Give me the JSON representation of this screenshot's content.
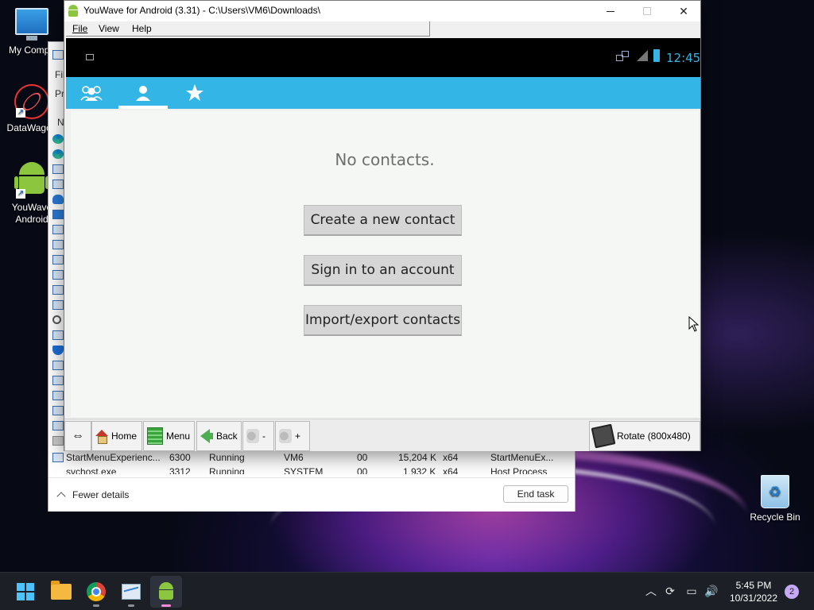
{
  "desktop": {
    "icons": [
      {
        "label": "My Compu",
        "icon": "computer-icon"
      },
      {
        "label": "DataWagon",
        "icon": "datawagon-icon"
      },
      {
        "label": "YouWave Android",
        "line1": "YouWave",
        "line2": "Android",
        "icon": "android-icon"
      },
      {
        "label": "Recycle Bin",
        "icon": "recycle-bin-icon"
      }
    ]
  },
  "taskmgr": {
    "left_labels": [
      "Fil",
      "Pr",
      "N"
    ],
    "rows": [
      {
        "name": "StartMenuExperienc...",
        "pid": "6300",
        "status": "Running",
        "user": "VM6",
        "cpu": "00",
        "memory": "15,204 K",
        "arch": "x64",
        "desc": "StartMenuEx..."
      },
      {
        "name": "svchost.exe",
        "pid": "3312",
        "status": "Running",
        "user": "SYSTEM",
        "cpu": "00",
        "memory": "1,932 K",
        "arch": "x64",
        "desc": "Host Process"
      }
    ],
    "fewer_details": "Fewer details",
    "end_task": "End task"
  },
  "youwave": {
    "title": "YouWave for Android (3.31) - C:\\Users\\VM6\\Downloads\\",
    "menu": {
      "file": "File",
      "view": "View",
      "help": "Help"
    },
    "status_bar": {
      "clock": "12:45",
      "battery_color": "#33b5e5"
    },
    "tabs": [
      {
        "name": "groups",
        "icon": "groups-icon"
      },
      {
        "name": "contacts",
        "icon": "person-icon",
        "selected": true
      },
      {
        "name": "favorites",
        "icon": "star-icon"
      }
    ],
    "accent": "#33b5e5",
    "content": {
      "empty_message": "No contacts.",
      "btn_create": "Create a new contact",
      "btn_signin": "Sign in to an account",
      "btn_import": "Import/export contacts"
    },
    "toolbar": {
      "home": "Home",
      "menu": "Menu",
      "back": "Back",
      "vol_down": "-",
      "vol_up": "+",
      "rotate": "Rotate (800x480)"
    }
  },
  "taskbar": {
    "apps": [
      "start-icon",
      "file-explorer-icon",
      "chrome-icon",
      "task-manager-icon",
      "youwave-icon"
    ],
    "time": "5:45 PM",
    "date": "10/31/2022",
    "notifications": "2"
  }
}
